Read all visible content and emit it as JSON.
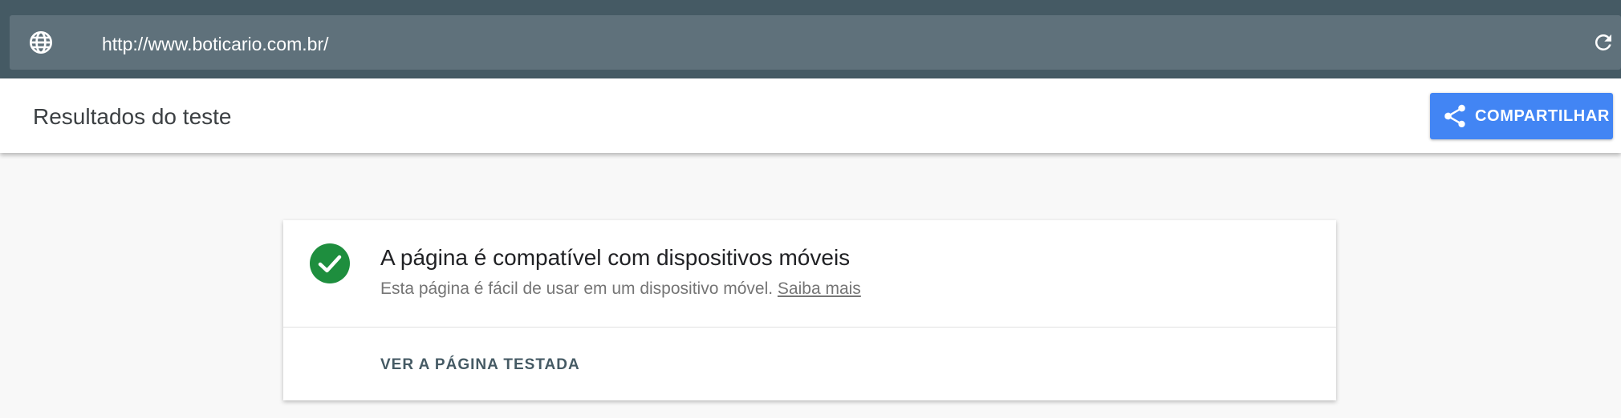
{
  "browser": {
    "url": "http://www.boticario.com.br/",
    "globe_icon": "globe-icon",
    "reload_icon": "reload-icon"
  },
  "header": {
    "title": "Resultados do teste",
    "share_label": "COMPARTILHAR",
    "share_icon": "share-icon"
  },
  "result": {
    "status_icon": "check-circle-icon",
    "title": "A página é compatível com dispositivos móveis",
    "description": "Esta página é fácil de usar em um dispositivo móvel.",
    "learn_more": "Saiba mais",
    "view_tested_page": "VER A PÁGINA TESTADA"
  },
  "colors": {
    "topbar": "#455a64",
    "urlbar": "#5f717b",
    "accent": "#4285f4",
    "success": "#1e8e3e"
  }
}
